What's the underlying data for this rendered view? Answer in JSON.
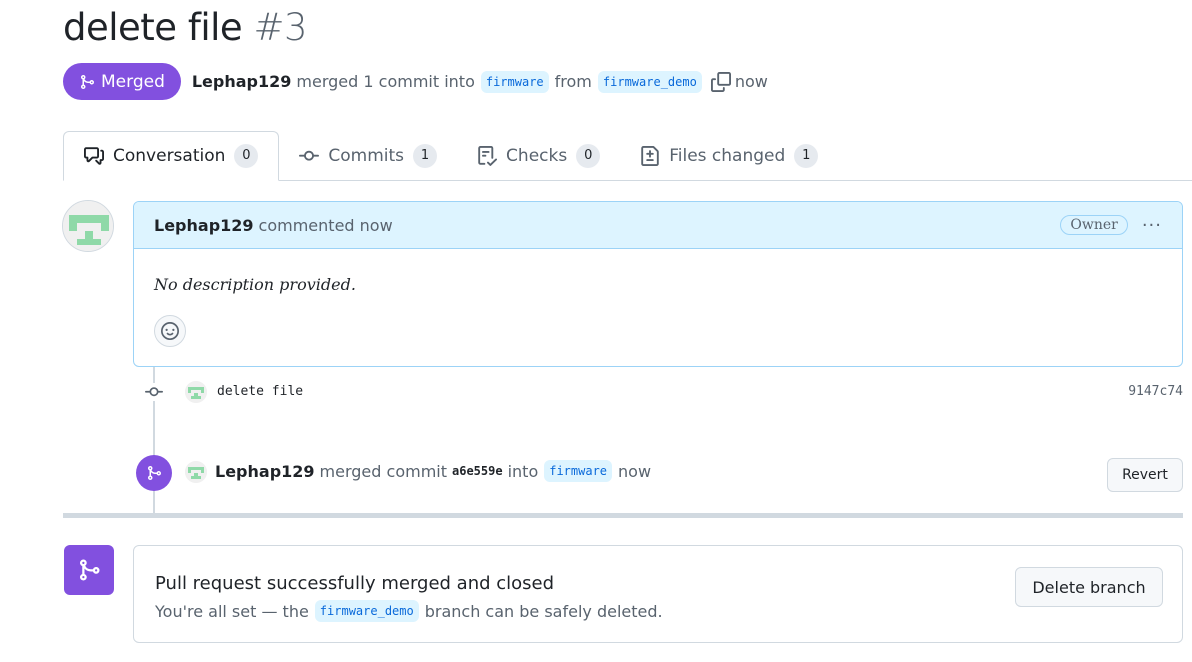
{
  "pr": {
    "title": "delete file",
    "number": "#3",
    "state_label": "Merged",
    "author": "Lephap129",
    "action_text": "merged 1 commit into",
    "base_branch": "firmware",
    "from_text": "from",
    "head_branch": "firmware_demo",
    "time": "now"
  },
  "tabs": [
    {
      "label": "Conversation",
      "count": "0",
      "icon": "comment-discussion-icon"
    },
    {
      "label": "Commits",
      "count": "1",
      "icon": "commit-icon"
    },
    {
      "label": "Checks",
      "count": "0",
      "icon": "checklist-icon"
    },
    {
      "label": "Files changed",
      "count": "1",
      "icon": "file-diff-icon"
    }
  ],
  "comment": {
    "author": "Lephap129",
    "action": "commented now",
    "badge": "Owner",
    "menu": "···",
    "body": "No description provided."
  },
  "commit": {
    "message": "delete file",
    "sha": "9147c74"
  },
  "merge_event": {
    "author": "Lephap129",
    "text1": "merged commit",
    "sha": "a6e559e",
    "text2": "into",
    "branch": "firmware",
    "time": "now",
    "revert_label": "Revert"
  },
  "merged_box": {
    "title": "Pull request successfully merged and closed",
    "sub_before": "You're all set — the",
    "branch": "firmware_demo",
    "sub_after": "branch can be safely deleted.",
    "delete_label": "Delete branch"
  },
  "colors": {
    "merged_purple": "#8250df",
    "branch_bg": "#ddf4ff",
    "branch_fg": "#0969da",
    "avatar_green": "#8fd9a8"
  }
}
